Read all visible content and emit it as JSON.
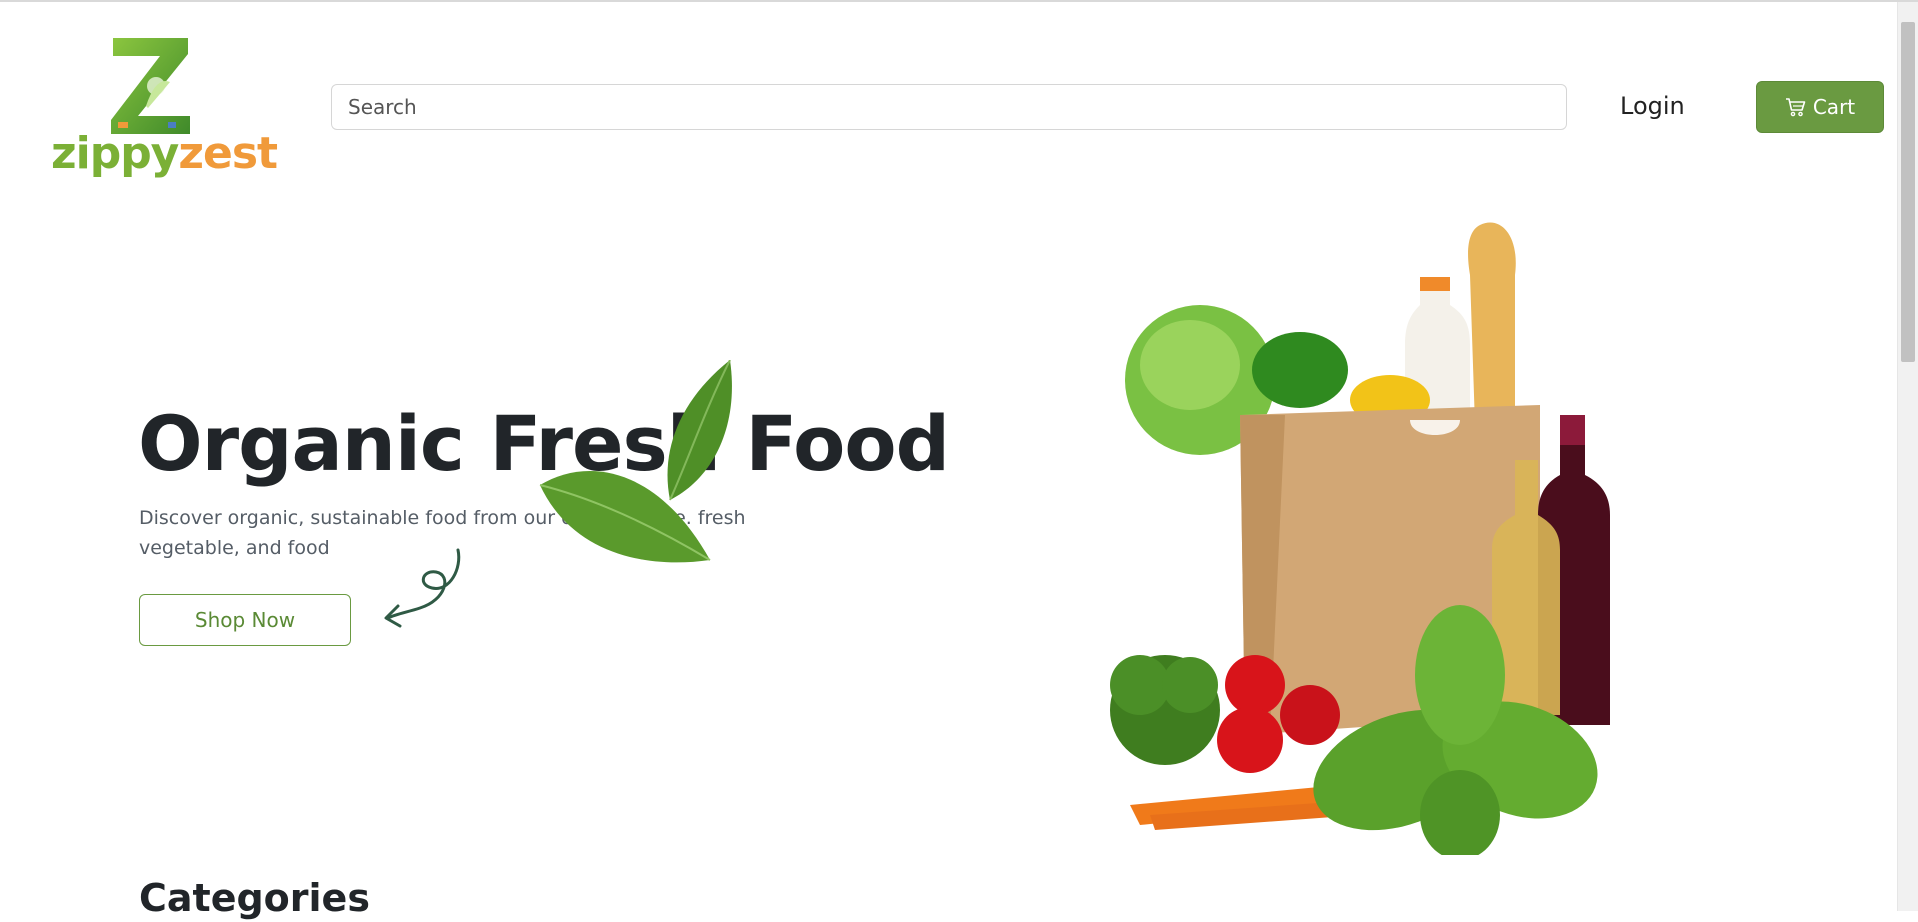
{
  "brand": {
    "logo_text_part1": "zippy",
    "logo_text_part2": "zest",
    "primary_color": "#6a9a41",
    "accent_color": "#f09a3a"
  },
  "header": {
    "search_placeholder": "Search",
    "login_label": "Login",
    "cart_label": "Cart",
    "cart_icon": "cart-icon"
  },
  "hero": {
    "title": "Organic Fresh Food",
    "description": "Discover organic, sustainable food from our organic store. fresh vegetable, and food",
    "button_label": "Shop Now",
    "image": "grocery-bag-image"
  },
  "sections": {
    "categories_title": "Categories"
  }
}
